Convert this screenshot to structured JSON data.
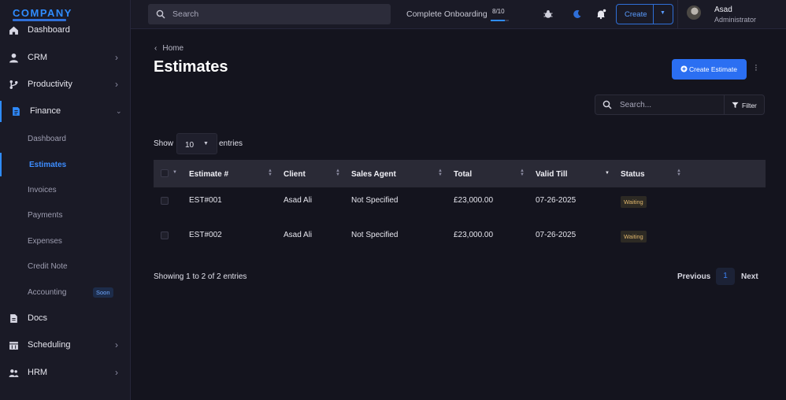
{
  "brand": {
    "name": "COMPANY"
  },
  "sidebar": {
    "items": [
      {
        "label": "Dashboard",
        "icon": "home-icon"
      },
      {
        "label": "CRM",
        "icon": "user-icon"
      },
      {
        "label": "Productivity",
        "icon": "git-branch-icon"
      },
      {
        "label": "Finance",
        "icon": "invoice-icon"
      },
      {
        "label": "Docs",
        "icon": "document-icon"
      },
      {
        "label": "Scheduling",
        "icon": "calendar-icon"
      },
      {
        "label": "HRM",
        "icon": "users-icon"
      }
    ],
    "finance_sub": [
      {
        "label": "Dashboard"
      },
      {
        "label": "Estimates"
      },
      {
        "label": "Invoices"
      },
      {
        "label": "Payments"
      },
      {
        "label": "Expenses"
      },
      {
        "label": "Credit Note"
      },
      {
        "label": "Accounting",
        "badge": "Soon"
      }
    ],
    "accent_color": "#2f8cff"
  },
  "topbar": {
    "search_placeholder": "Search",
    "onboarding_label": "Complete Onboarding",
    "onboarding_count": "8/10",
    "onboarding_progress": 0.8,
    "create_label": "Create",
    "user_name": "Asad",
    "user_role": "Administrator"
  },
  "page": {
    "breadcrumb": "Home",
    "title": "Estimates",
    "create_button": "Create Estimate",
    "filter_placeholder": "Search...",
    "filter_button": "Filter",
    "show_label": "Show",
    "entries_value": "10",
    "entries_label": "entries"
  },
  "table": {
    "headers": [
      "Estimate #",
      "Client",
      "Sales Agent",
      "Total",
      "Valid Till",
      "Status"
    ],
    "rows": [
      {
        "estimate": "EST#001",
        "client": "Asad Ali",
        "agent": "Not Specified",
        "total": "£23,000.00",
        "valid_till": "07-26-2025",
        "status": "Waiting"
      },
      {
        "estimate": "EST#002",
        "client": "Asad Ali",
        "agent": "Not Specified",
        "total": "£23,000.00",
        "valid_till": "07-26-2025",
        "status": "Waiting"
      }
    ]
  },
  "pagination": {
    "info": "Showing 1 to 2 of 2 entries",
    "previous": "Previous",
    "current_page": "1",
    "next": "Next"
  }
}
